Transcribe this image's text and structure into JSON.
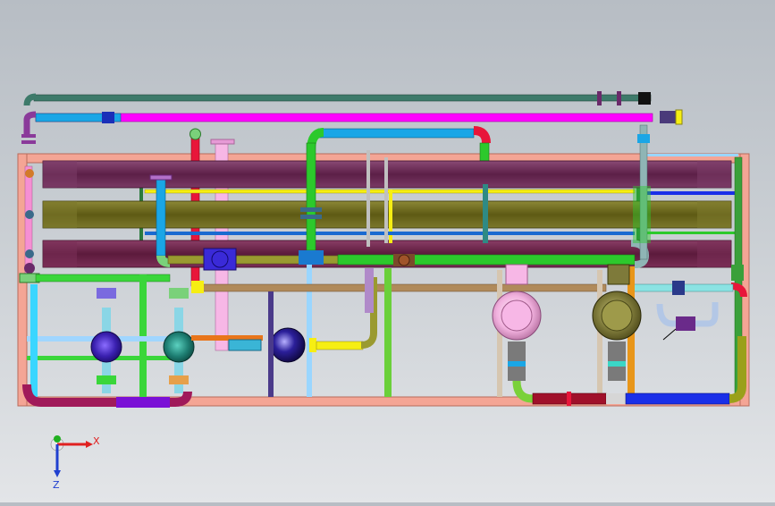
{
  "viewport": {
    "model": "skid-piping-assembly",
    "view_orientation": "top"
  },
  "triad": {
    "x_label": "X",
    "z_label": "Z",
    "x_color": "#e02020",
    "z_color": "#2040d0",
    "y_color": "#20b020"
  },
  "colors": {
    "frame": "#f4a595",
    "header_1": "#6e2d58",
    "header_2": "#6f6b1d",
    "header_3": "#6e2248",
    "magenta_pipe": "#ff00ff",
    "cyan_pipe": "#1aa6e6",
    "green_pipe": "#2cc92c",
    "yellow_pipe": "#f6ee13",
    "red_pipe": "#e8163a",
    "blue_pipe": "#1a2fe8",
    "pink_tank": "#f7b7e6",
    "olive_tank": "#7e7a3a"
  }
}
